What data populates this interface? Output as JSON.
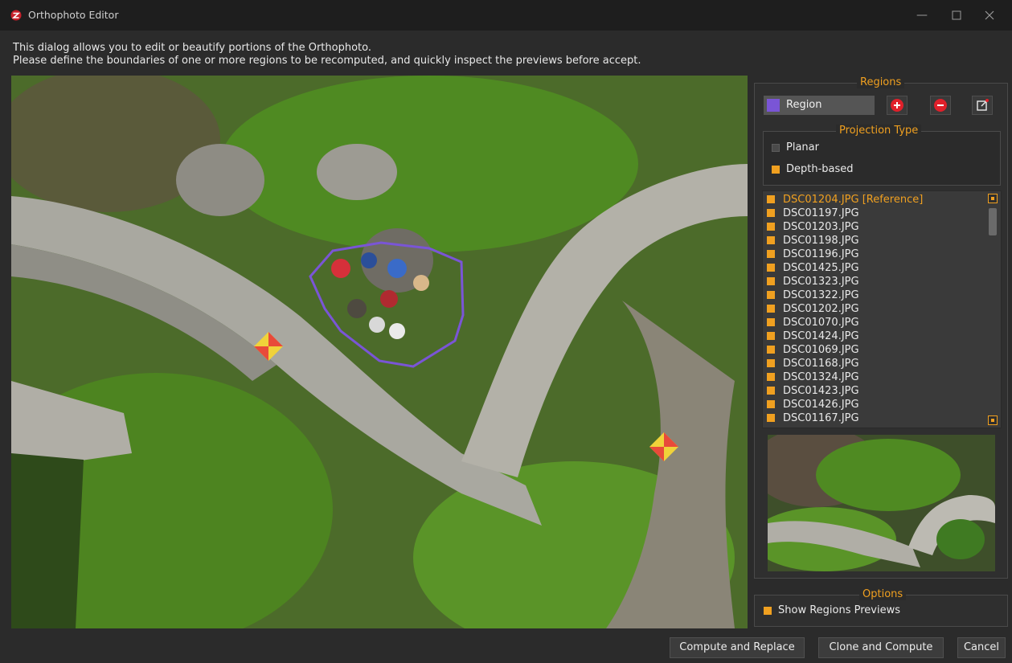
{
  "window": {
    "title": "Orthophoto Editor"
  },
  "description": {
    "line1": "This dialog allows you to edit or beautify portions of the Orthophoto.",
    "line2": "Please define the boundaries of one or more regions to be recomputed, and quickly inspect the previews before accept."
  },
  "regions": {
    "group_title": "Regions",
    "selected_label": "Region",
    "selected_color": "#7a55d6",
    "add_icon": "plus-circle-icon",
    "remove_icon": "minus-circle-icon",
    "edit_icon": "edit-icon"
  },
  "projection": {
    "group_title": "Projection Type",
    "options": [
      {
        "label": "Planar",
        "checked": false
      },
      {
        "label": "Depth-based",
        "checked": true
      }
    ]
  },
  "images": [
    {
      "label": "DSC01204.JPG [Reference]",
      "reference": true
    },
    {
      "label": "DSC01197.JPG"
    },
    {
      "label": "DSC01203.JPG"
    },
    {
      "label": "DSC01198.JPG"
    },
    {
      "label": "DSC01196.JPG"
    },
    {
      "label": "DSC01425.JPG"
    },
    {
      "label": "DSC01323.JPG"
    },
    {
      "label": "DSC01322.JPG"
    },
    {
      "label": "DSC01202.JPG"
    },
    {
      "label": "DSC01070.JPG"
    },
    {
      "label": "DSC01424.JPG"
    },
    {
      "label": "DSC01069.JPG"
    },
    {
      "label": "DSC01168.JPG"
    },
    {
      "label": "DSC01324.JPG"
    },
    {
      "label": "DSC01423.JPG"
    },
    {
      "label": "DSC01426.JPG"
    },
    {
      "label": "DSC01167.JPG"
    }
  ],
  "options": {
    "group_title": "Options",
    "show_previews_label": "Show Regions Previews",
    "show_previews_checked": true
  },
  "buttons": {
    "compute_replace": "Compute and Replace",
    "clone_compute": "Clone and Compute",
    "cancel": "Cancel"
  },
  "colors": {
    "accent": "#f0a020",
    "region_outline": "#7a55d6",
    "add_button": "#e0202a",
    "remove_button": "#e0202a"
  }
}
